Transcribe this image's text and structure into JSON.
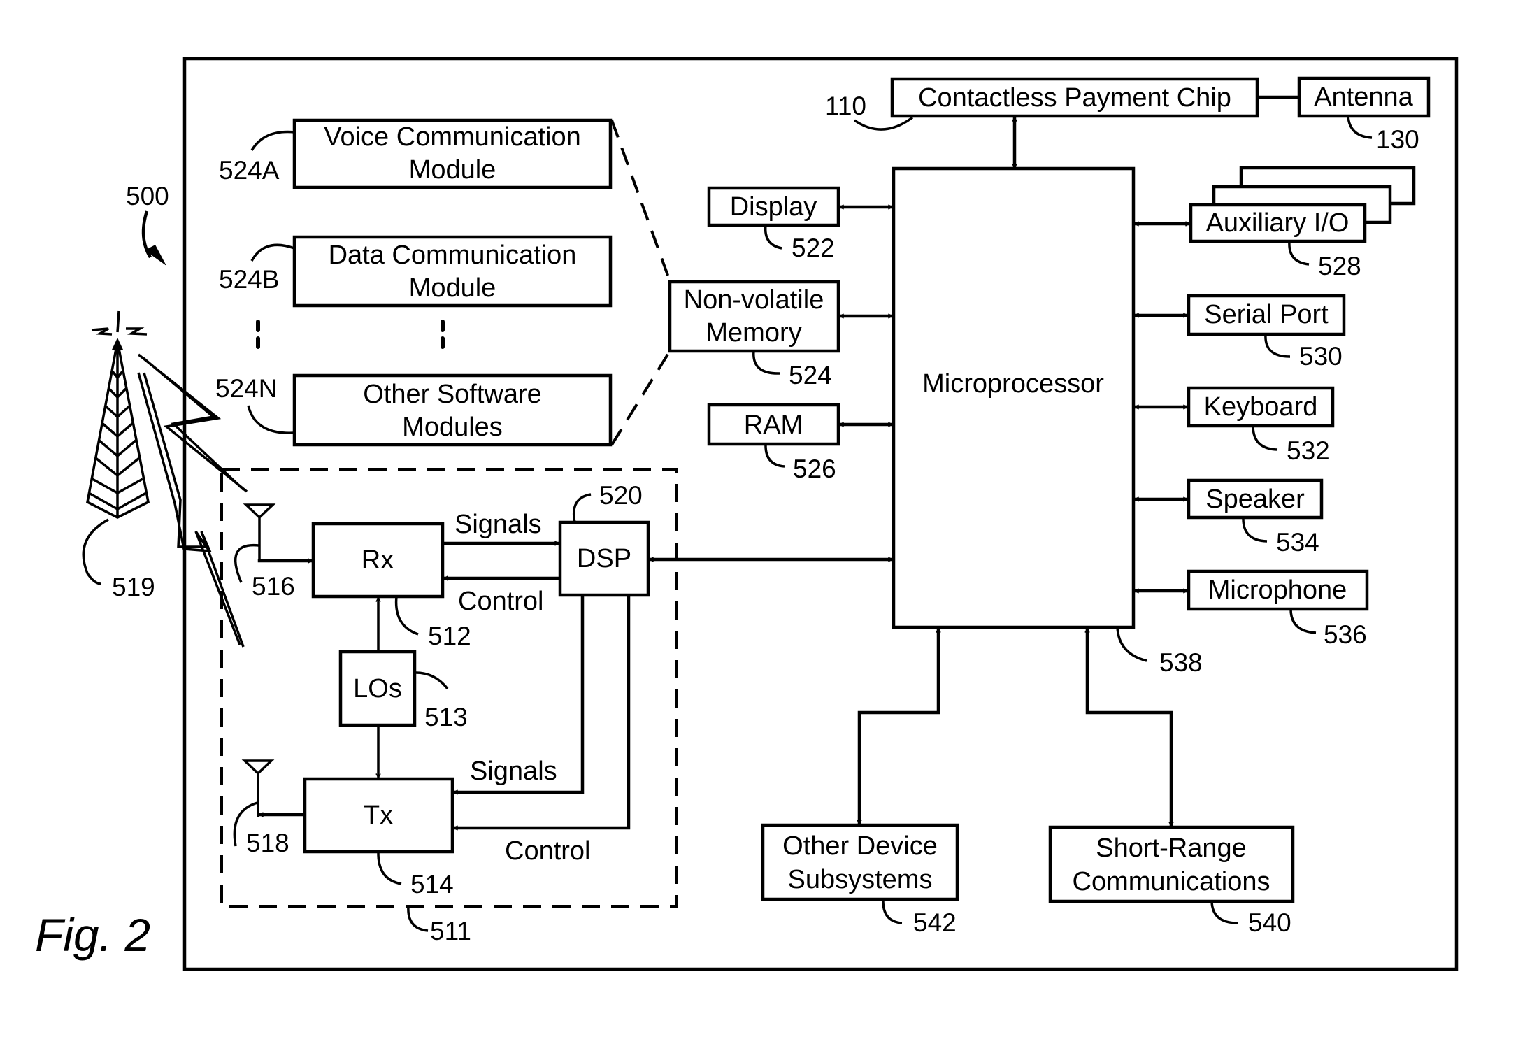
{
  "figure": {
    "caption": "Fig. 2",
    "device_ref": "500"
  },
  "modules": [
    {
      "ref": "524A",
      "line1": "Voice Communication",
      "line2": "Module"
    },
    {
      "ref": "524B",
      "line1": "Data Communication",
      "line2": "Module"
    },
    {
      "ref": "524N",
      "line1": "Other Software",
      "line2": "Modules"
    }
  ],
  "memory": {
    "display": {
      "label": "Display",
      "ref": "522"
    },
    "nonvolatile": {
      "line1": "Non-volatile",
      "line2": "Memory",
      "ref": "524"
    },
    "ram": {
      "label": "RAM",
      "ref": "526"
    }
  },
  "payment": {
    "chip": {
      "label": "Contactless Payment Chip",
      "ref": "110"
    },
    "antenna": {
      "label": "Antenna",
      "ref": "130"
    }
  },
  "microprocessor": {
    "label": "Microprocessor",
    "ref": "538"
  },
  "peripherals": [
    {
      "label": "Auxiliary I/O",
      "ref": "528"
    },
    {
      "label": "Serial Port",
      "ref": "530"
    },
    {
      "label": "Keyboard",
      "ref": "532"
    },
    {
      "label": "Speaker",
      "ref": "534"
    },
    {
      "label": "Microphone",
      "ref": "536"
    }
  ],
  "subsystems": {
    "other": {
      "line1": "Other Device",
      "line2": "Subsystems",
      "ref": "542"
    },
    "short_range": {
      "line1": "Short-Range",
      "line2": "Communications",
      "ref": "540"
    }
  },
  "radio": {
    "subsystem_ref": "511",
    "rx": {
      "label": "Rx",
      "ref": "512"
    },
    "los": {
      "label": "LOs",
      "ref": "513"
    },
    "tx": {
      "label": "Tx",
      "ref": "514"
    },
    "dsp": {
      "label": "DSP",
      "ref": "520"
    },
    "rx_antenna_ref": "516",
    "tx_antenna_ref": "518",
    "tower_ref": "519",
    "rx_signals": "Signals",
    "rx_control": "Control",
    "tx_signals": "Signals",
    "tx_control": "Control"
  }
}
